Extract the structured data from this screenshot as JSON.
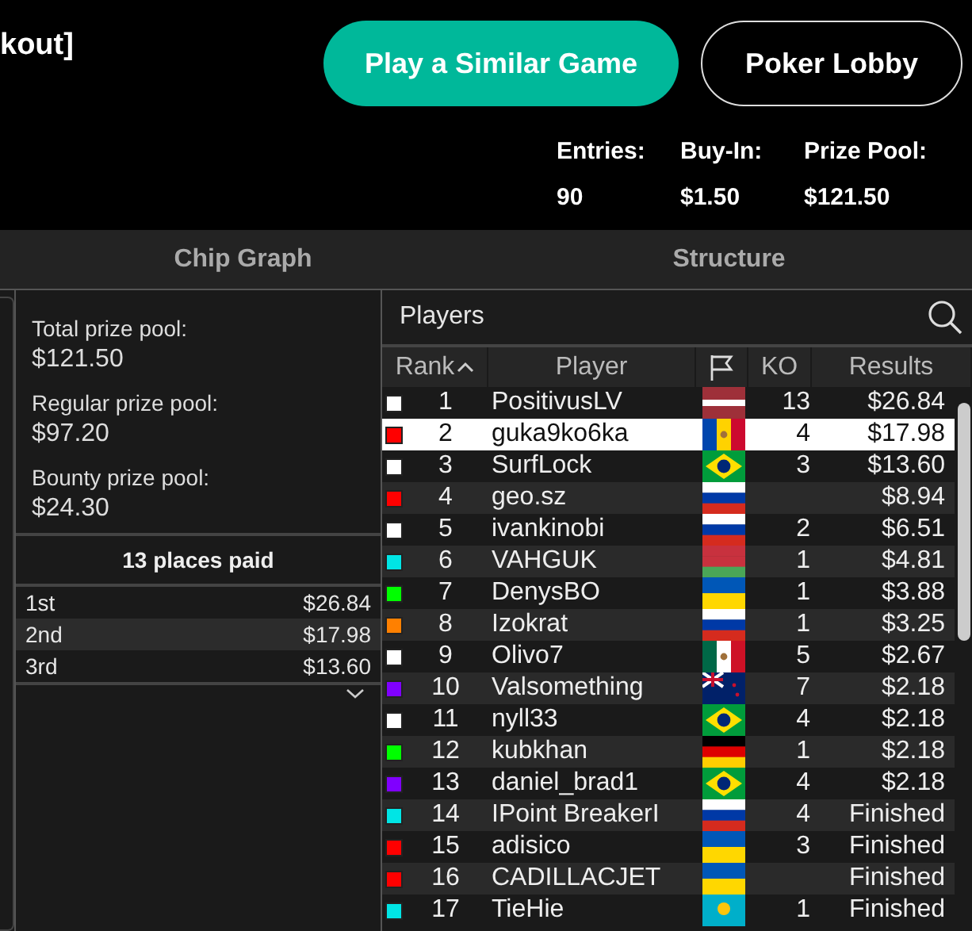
{
  "header": {
    "title": "kout]",
    "buttons": [
      {
        "label": "Play a Similar Game",
        "kind": "primary"
      },
      {
        "label": "Poker Lobby",
        "kind": "outline"
      }
    ],
    "stats": [
      {
        "label": "Entries:",
        "value": "90"
      },
      {
        "label": "Buy-In:",
        "value": "$1.50"
      },
      {
        "label": "Prize Pool:",
        "value": "$121.50"
      }
    ]
  },
  "tabs": [
    {
      "label": "Chip Graph",
      "selected": false
    },
    {
      "label": "Structure",
      "selected": false
    }
  ],
  "prize_pools": [
    {
      "label": "Total prize pool:",
      "value": "$121.50"
    },
    {
      "label": "Regular prize pool:",
      "value": "$97.20"
    },
    {
      "label": "Bounty prize pool:",
      "value": "$24.30"
    }
  ],
  "payouts": {
    "title": "13 places paid",
    "rows": [
      {
        "place": "1st",
        "amount": "$26.84"
      },
      {
        "place": "2nd",
        "amount": "$17.98"
      },
      {
        "place": "3rd",
        "amount": "$13.60"
      }
    ]
  },
  "players": {
    "title": "Players",
    "columns": [
      "Rank",
      "Player",
      "KO",
      "Results"
    ],
    "rows": [
      {
        "color": "#ffffff",
        "rank": "1",
        "player": "PositivusLV",
        "kind": "lv",
        "ko": "13",
        "result": "$26.84",
        "selected": false
      },
      {
        "color": "#ff0000",
        "rank": "2",
        "player": "guka9ko6ka",
        "kind": "md",
        "ko": "4",
        "result": "$17.98",
        "selected": true
      },
      {
        "color": "#ffffff",
        "rank": "3",
        "player": "SurfLock",
        "kind": "br",
        "ko": "3",
        "result": "$13.60",
        "selected": false
      },
      {
        "color": "#ff0000",
        "rank": "4",
        "player": "geo.sz",
        "kind": "ru",
        "result": "$8.94",
        "selected": false
      },
      {
        "color": "#ffffff",
        "rank": "5",
        "player": "ivankinobi",
        "kind": "ru",
        "ko": "2",
        "result": "$6.51",
        "selected": false
      },
      {
        "color": "#00e5e5",
        "rank": "6",
        "player": "VAHGUK",
        "kind": "by",
        "ko": "1",
        "result": "$4.81",
        "selected": false
      },
      {
        "color": "#00ff00",
        "rank": "7",
        "player": "DenysBO",
        "kind": "ua",
        "ko": "1",
        "result": "$3.88",
        "selected": false
      },
      {
        "color": "#ff8000",
        "rank": "8",
        "player": "Izokrat",
        "kind": "ru",
        "ko": "1",
        "result": "$3.25",
        "selected": false
      },
      {
        "color": "#ffffff",
        "rank": "9",
        "player": "Olivo7",
        "kind": "mx",
        "ko": "5",
        "result": "$2.67",
        "selected": false
      },
      {
        "color": "#8000ff",
        "rank": "10",
        "player": "Valsomething",
        "kind": "nz",
        "ko": "7",
        "result": "$2.18",
        "selected": false
      },
      {
        "color": "#ffffff",
        "rank": "11",
        "player": "nyll33",
        "kind": "br",
        "ko": "4",
        "result": "$2.18",
        "selected": false
      },
      {
        "color": "#00ff00",
        "rank": "12",
        "player": "kubkhan",
        "kind": "de",
        "ko": "1",
        "result": "$2.18",
        "selected": false
      },
      {
        "color": "#8000ff",
        "rank": "13",
        "player": "daniel_brad1",
        "kind": "br",
        "ko": "4",
        "result": "$2.18",
        "selected": false
      },
      {
        "color": "#00e5e5",
        "rank": "14",
        "player": "IPoint BreakerI",
        "kind": "ru",
        "ko": "4",
        "result": "Finished",
        "selected": false
      },
      {
        "color": "#ff0000",
        "rank": "15",
        "player": "adisico",
        "kind": "ua",
        "ko": "3",
        "result": "Finished",
        "selected": false
      },
      {
        "color": "#ff0000",
        "rank": "16",
        "player": "CADILLACJET",
        "kind": "ua",
        "result": "Finished",
        "selected": false
      },
      {
        "color": "#00e5e5",
        "rank": "17",
        "player": "TieHie",
        "kind": "kz",
        "ko": "1",
        "result": "Finished",
        "selected": false
      }
    ]
  }
}
